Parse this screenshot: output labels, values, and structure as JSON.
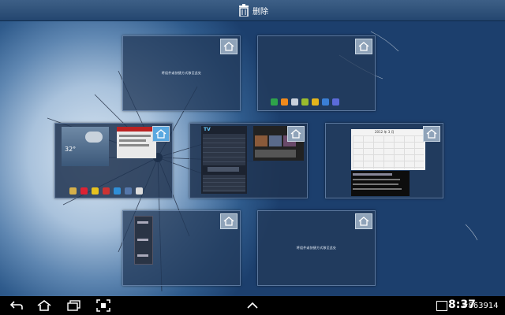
{
  "topbar": {
    "delete_label": "删除"
  },
  "panels": {
    "top_left_text": "将组件或快捷方式移至此处",
    "bottom_right_text": "将组件或快捷方式移至此处",
    "weather_temp": "32°",
    "tv_title": "TV",
    "calendar_title": "2012 年 3 月"
  },
  "statusbar": {
    "time": "8:37"
  },
  "watermark": "#863914",
  "colors": {
    "topbar": "#2f5279",
    "panel_border": "#8caad2",
    "home_badge": "#8fa3b9"
  }
}
